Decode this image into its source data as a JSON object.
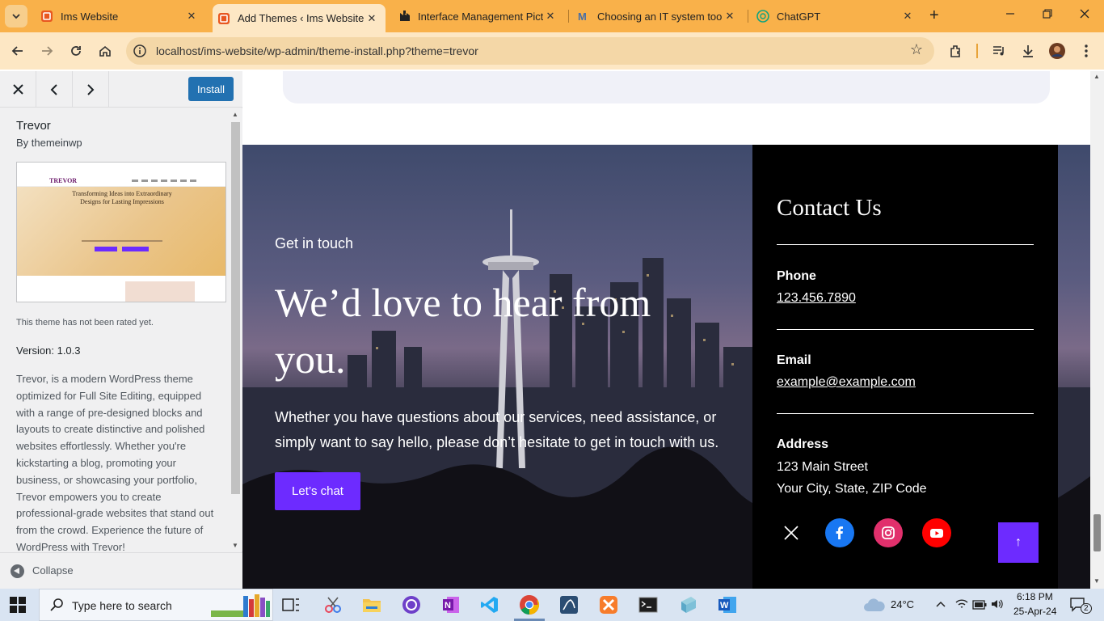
{
  "browser": {
    "tabs": [
      {
        "title": "Ims Website",
        "close": "✕"
      },
      {
        "title": "Add Themes ‹ Ims Website",
        "close": "✕"
      },
      {
        "title": "Interface Management Pict",
        "close": "✕"
      },
      {
        "title": "Choosing an IT system tool",
        "close": "✕"
      },
      {
        "title": "ChatGPT",
        "close": "✕"
      }
    ],
    "new_tab": "+",
    "url": "localhost/ims-website/wp-admin/theme-install.php?theme=trevor"
  },
  "sidebar": {
    "install_label": "Install",
    "theme_name": "Trevor",
    "author": "By themeinwp",
    "screenshot": {
      "logo": "TREVOR",
      "headline": "Transforming Ideas into Extraordinary Designs for Lasting Impressions"
    },
    "rating_text": "This theme has not been rated yet.",
    "version": "Version: 1.0.3",
    "description": "Trevor, is a modern WordPress theme optimized for Full Site Editing, equipped with a range of pre-designed blocks and layouts to create distinctive and polished websites effortlessly. Whether you're kickstarting a blog, promoting your business, or showcasing your portfolio, Trevor empowers you to create professional-grade websites that stand out from the crowd. Experience the future of WordPress with Trevor!",
    "collapse_label": "Collapse"
  },
  "preview": {
    "eyebrow": "Get in touch",
    "heading": "We’d love to hear from you.",
    "paragraph": "Whether you have questions about our services, need assistance, or simply want to say hello, please don’t hesitate to get in touch with us.",
    "cta": "Let’s chat",
    "contact": {
      "title": "Contact Us",
      "phone_label": "Phone",
      "phone": "123.456.7890",
      "email_label": "Email",
      "email": "example@example.com",
      "address_label": "Address",
      "address_line1": "123 Main Street",
      "address_line2": "Your City, State, ZIP Code"
    },
    "social": [
      "x-icon",
      "facebook-icon",
      "instagram-icon",
      "youtube-icon"
    ],
    "back_to_top": "↑",
    "accent_color": "#6d2bff"
  },
  "taskbar": {
    "search_placeholder": "Type here to search",
    "weather": "24°C",
    "time": "6:18 PM",
    "date": "25-Apr-24",
    "notifications": "2"
  }
}
